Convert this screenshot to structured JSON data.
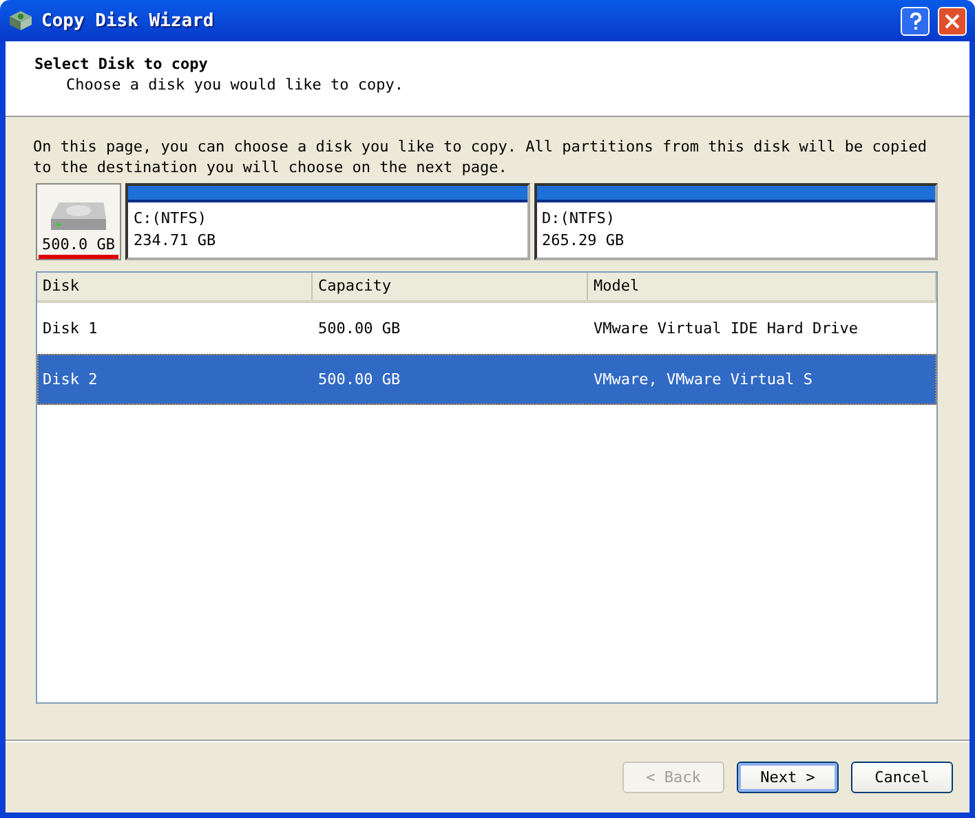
{
  "window": {
    "title": "Copy Disk Wizard"
  },
  "header": {
    "title": "Select Disk to copy",
    "subtitle": "Choose a disk you would like to copy."
  },
  "description": "On this page, you can choose a disk you like to copy. All partitions from this disk will be copied to the destination you will choose on the next page.",
  "disk_map": {
    "disk_size": "500.0 GB",
    "selected": true,
    "partitions": [
      {
        "label": "C:(NTFS)",
        "size": "234.71 GB"
      },
      {
        "label": "D:(NTFS)",
        "size": "265.29 GB"
      }
    ]
  },
  "table": {
    "columns": [
      "Disk",
      "Capacity",
      "Model"
    ],
    "rows": [
      {
        "cells": [
          "Disk 1",
          "500.00 GB",
          "VMware Virtual IDE Hard Drive"
        ],
        "selected": false
      },
      {
        "cells": [
          "Disk 2",
          "500.00 GB",
          "VMware, VMware Virtual S"
        ],
        "selected": true
      }
    ]
  },
  "buttons": [
    {
      "label": "< Back",
      "disabled": true,
      "default": false
    },
    {
      "label": "Next >",
      "disabled": false,
      "default": true
    },
    {
      "label": "Cancel",
      "disabled": false,
      "default": false
    }
  ]
}
